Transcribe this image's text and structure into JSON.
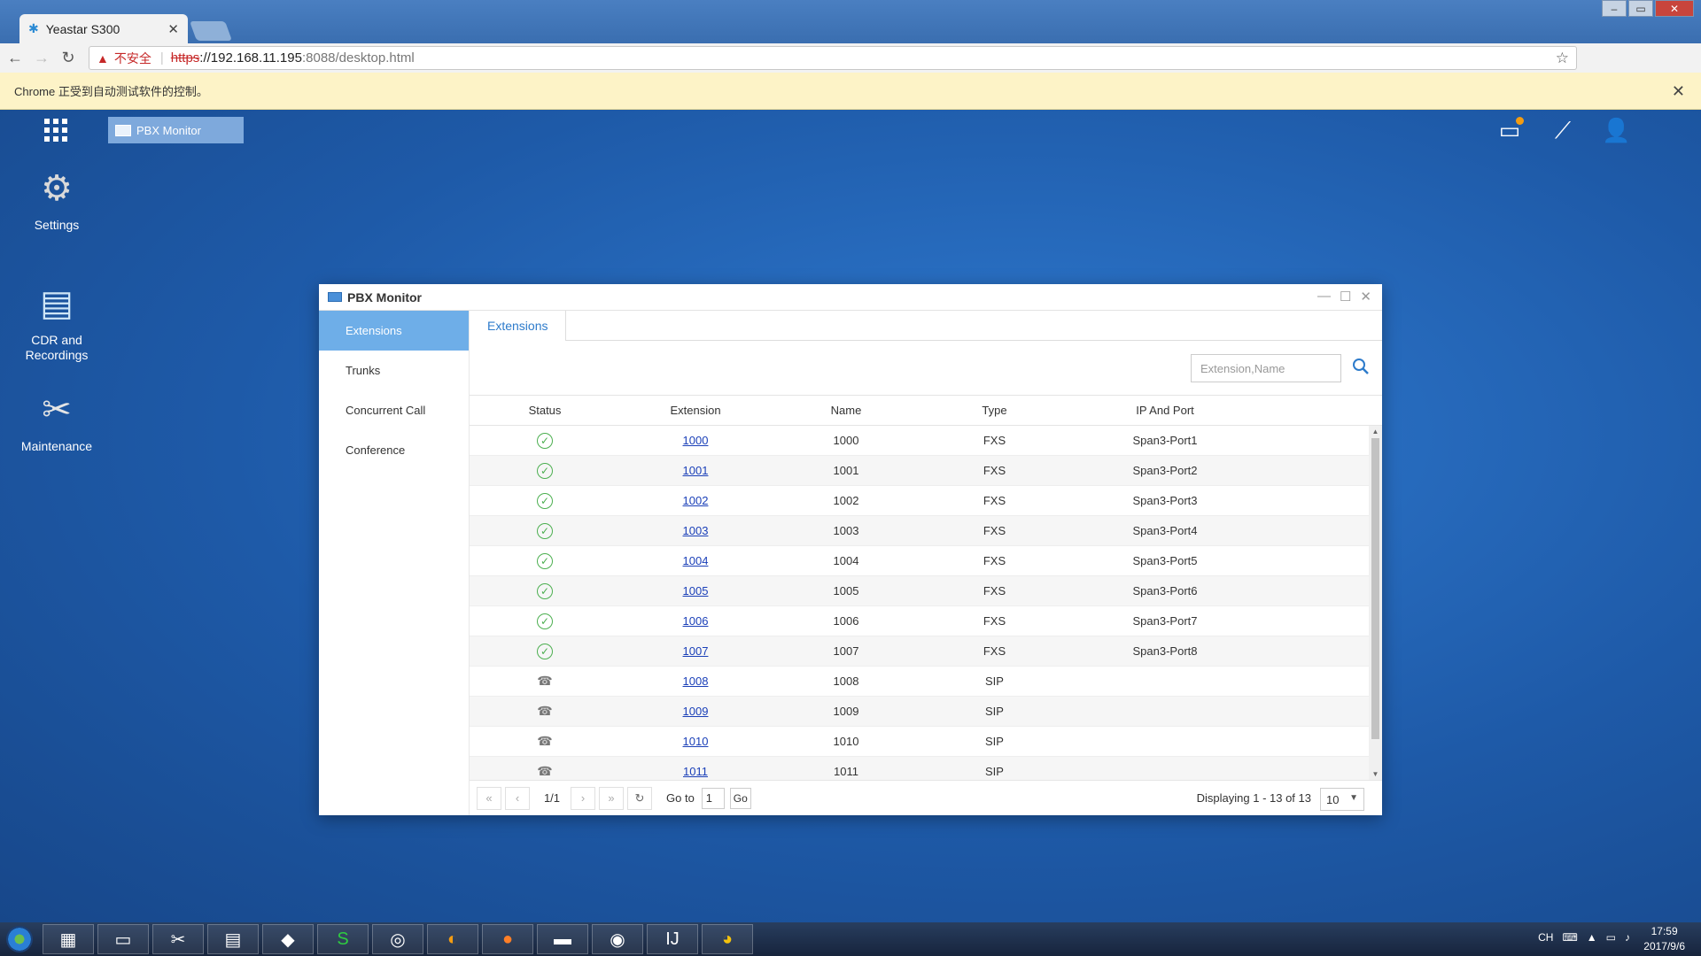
{
  "browser": {
    "tab_title": "Yeastar S300",
    "tab_close": "✕",
    "insecure_label": "不安全",
    "url_scheme": "https",
    "url_host": "://192.168.11.195",
    "url_path": ":8088/desktop.html",
    "infobar_text": "Chrome 正受到自动测试软件的控制。"
  },
  "desktop": {
    "taskbutton_label": "PBX Monitor",
    "icons": [
      {
        "label": "Settings"
      },
      {
        "label": "CDR and Recordings"
      },
      {
        "label": "Maintenance"
      }
    ]
  },
  "window": {
    "title": "PBX Monitor",
    "sidebar": [
      "Extensions",
      "Trunks",
      "Concurrent Call",
      "Conference"
    ],
    "tab": "Extensions",
    "search_placeholder": "Extension,Name",
    "columns": [
      "Status",
      "Extension",
      "Name",
      "Type",
      "IP And Port"
    ],
    "rows": [
      {
        "status": "registered",
        "extension": "1000",
        "name": "1000",
        "type": "FXS",
        "ip": "Span3-Port1"
      },
      {
        "status": "registered",
        "extension": "1001",
        "name": "1001",
        "type": "FXS",
        "ip": "Span3-Port2"
      },
      {
        "status": "registered",
        "extension": "1002",
        "name": "1002",
        "type": "FXS",
        "ip": "Span3-Port3"
      },
      {
        "status": "registered",
        "extension": "1003",
        "name": "1003",
        "type": "FXS",
        "ip": "Span3-Port4"
      },
      {
        "status": "registered",
        "extension": "1004",
        "name": "1004",
        "type": "FXS",
        "ip": "Span3-Port5"
      },
      {
        "status": "registered",
        "extension": "1005",
        "name": "1005",
        "type": "FXS",
        "ip": "Span3-Port6"
      },
      {
        "status": "registered",
        "extension": "1006",
        "name": "1006",
        "type": "FXS",
        "ip": "Span3-Port7"
      },
      {
        "status": "registered",
        "extension": "1007",
        "name": "1007",
        "type": "FXS",
        "ip": "Span3-Port8"
      },
      {
        "status": "idle",
        "extension": "1008",
        "name": "1008",
        "type": "SIP",
        "ip": ""
      },
      {
        "status": "idle",
        "extension": "1009",
        "name": "1009",
        "type": "SIP",
        "ip": ""
      },
      {
        "status": "idle",
        "extension": "1010",
        "name": "1010",
        "type": "SIP",
        "ip": ""
      },
      {
        "status": "idle",
        "extension": "1011",
        "name": "1011",
        "type": "SIP",
        "ip": ""
      }
    ],
    "pager": {
      "page": "1/1",
      "goto_label": "Go to",
      "goto_value": "1",
      "go_label": "Go",
      "displaying": "Displaying 1 - 13 of 13",
      "page_size": "10"
    }
  },
  "taskbar": {
    "tray_lang": "CH",
    "time": "17:59",
    "date": "2017/9/6"
  },
  "colors": {
    "desktop_bg": "#1f5fae",
    "accent": "#2d7bcb",
    "active_side": "#6eaee8",
    "status_ok": "#4caf50"
  }
}
